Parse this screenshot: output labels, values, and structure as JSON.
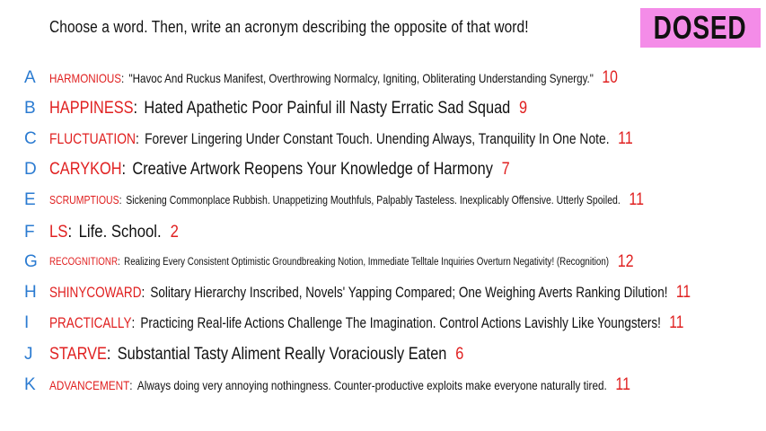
{
  "prompt": "Choose a word. Then, write an acronym describing the opposite of that word!",
  "logo": "DOSED",
  "colors": {
    "letter": "#2b7bd1",
    "word": "#e02020",
    "count": "#e02020",
    "text": "#111111",
    "logo_bg": "#f48ce8"
  },
  "rows": [
    {
      "letter": "A",
      "word": "HARMONIOUS",
      "acronym": "\"Havoc And Ruckus Manifest, Overthrowing Normalcy, Igniting, Obliterating Understanding Synergy.\"",
      "count": "10"
    },
    {
      "letter": "B",
      "word": "HAPPINESS",
      "acronym": "Hated Apathetic Poor Painful ill Nasty Erratic Sad Squad",
      "count": "9"
    },
    {
      "letter": "C",
      "word": "FLUCTUATION",
      "acronym": "Forever Lingering Under Constant Touch. Unending Always, Tranquility In One Note.",
      "count": "11"
    },
    {
      "letter": "D",
      "word": "CARYKOH",
      "acronym": "Creative Artwork Reopens Your Knowledge of Harmony",
      "count": "7"
    },
    {
      "letter": "E",
      "word": "SCRUMPTIOUS",
      "acronym": "Sickening Commonplace Rubbish. Unappetizing Mouthfuls, Palpably Tasteless. Inexplicably Offensive. Utterly Spoiled.",
      "count": "11"
    },
    {
      "letter": "F",
      "word": "LS",
      "acronym": "Life. School.",
      "count": "2"
    },
    {
      "letter": "G",
      "word": "RECOGNITIONR",
      "acronym": "Realizing Every Consistent Optimistic Groundbreaking Notion, Immediate Telltale Inquiries Overturn Negativity! (Recognition)",
      "count": "12"
    },
    {
      "letter": "H",
      "word": "SHINYCOWARD",
      "acronym": "Solitary Hierarchy Inscribed, Novels' Yapping Compared; One Weighing Averts Ranking Dilution!",
      "count": "11"
    },
    {
      "letter": "I",
      "word": "PRACTICALLY",
      "acronym": "Practicing Real-life Actions Challenge The Imagination. Control Actions Lavishly Like Youngsters!",
      "count": "11"
    },
    {
      "letter": "J",
      "word": "STARVE",
      "acronym": "Substantial Tasty Aliment Really Voraciously Eaten",
      "count": "6"
    },
    {
      "letter": "K",
      "word": "ADVANCEMENT",
      "acronym": "Always doing very annoying nothingness. Counter-productive exploits make everyone naturally tired.",
      "count": "11"
    }
  ]
}
